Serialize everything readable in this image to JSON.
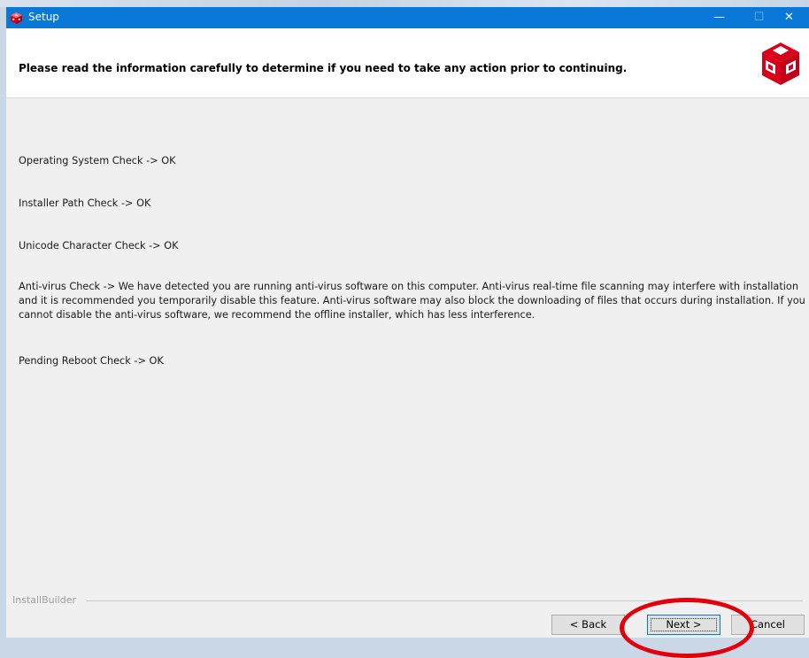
{
  "window": {
    "title": "Setup",
    "controls": {
      "minimize": "—",
      "maximize": "☐",
      "close": "✕"
    }
  },
  "header": {
    "instruction": "Please read the information carefully to determine if you need to take any action prior to continuing."
  },
  "checks": [
    {
      "text": "Operating System Check -> OK"
    },
    {
      "text": "Installer Path Check -> OK"
    },
    {
      "text": "Unicode Character Check ->  OK"
    },
    {
      "text": "Anti-virus Check -> We have detected you are running anti-virus software on this computer. Anti-virus real-time file scanning may interfere with installation and it is recommended you temporarily disable this feature. Anti-virus software may also block the downloading of files that occurs during installation. If you cannot disable the anti-virus software, we recommend the offline installer, which has less interference."
    },
    {
      "text": "Pending Reboot Check -> OK"
    }
  ],
  "footer": {
    "brand": "InstallBuilder",
    "back_label": "< Back",
    "next_label": "Next >",
    "cancel_label": "Cancel"
  },
  "colors": {
    "titlebar": "#0a78d7",
    "logo": "#d9001b",
    "annotation": "#e3000b"
  },
  "icons": {
    "title": "app-cube-icon",
    "logo": "cube-logo-icon"
  }
}
